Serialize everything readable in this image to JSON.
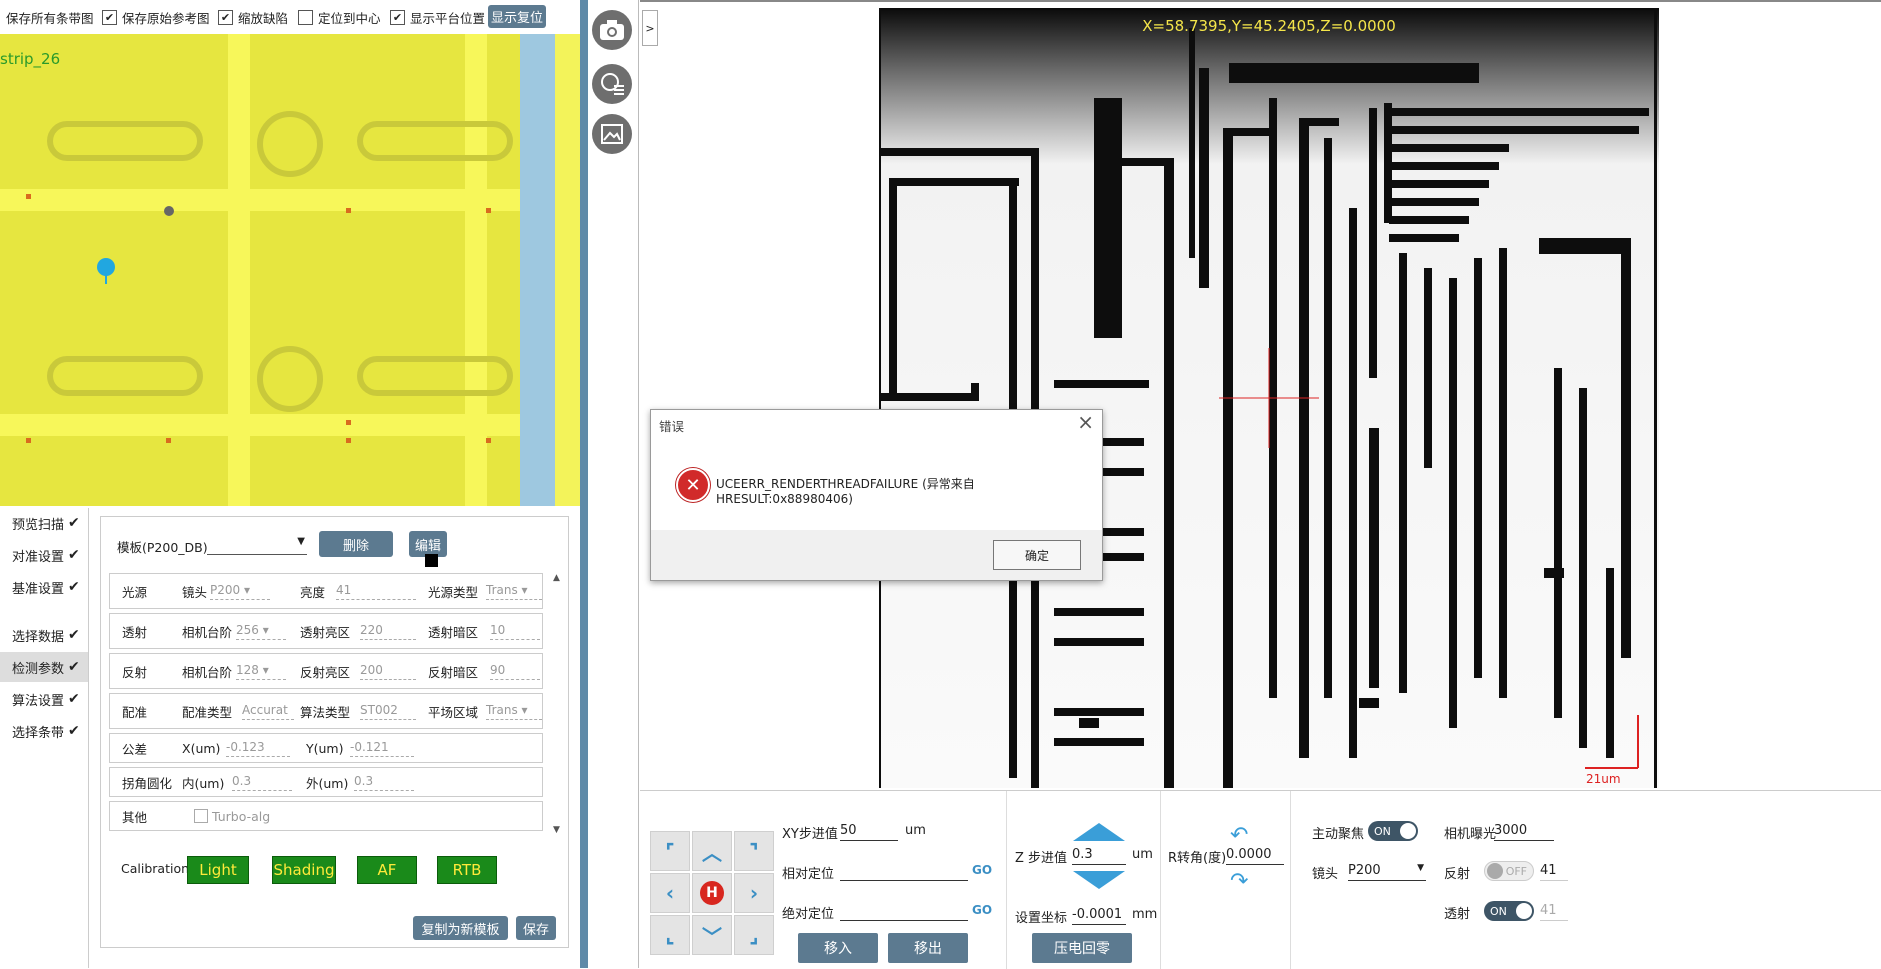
{
  "toolbar": {
    "save_all_strips": "保存所有条带图",
    "save_original_ref": "保存原始参考图",
    "zoom_defect": "缩放缺陷",
    "center_locate": "定位到中心",
    "show_platform_pos": "显示平台位置",
    "show_reset": "显示复位"
  },
  "map": {
    "strip_label": "strip_26"
  },
  "nav": {
    "items": [
      {
        "label": "预览扫描",
        "checked": "✔"
      },
      {
        "label": "对准设置",
        "checked": "✔"
      },
      {
        "label": "基准设置",
        "checked": "✔"
      },
      {
        "label": "选择数据",
        "checked": "✔"
      },
      {
        "label": "检测参数",
        "checked": "✔"
      },
      {
        "label": "算法设置",
        "checked": "✔"
      },
      {
        "label": "选择条带",
        "checked": "✔"
      }
    ]
  },
  "params": {
    "template_label": "模板(P200_DB)",
    "delete": "删除",
    "edit": "编辑",
    "rows": {
      "light": {
        "title": "光源",
        "lens_label": "镜头",
        "lens_val": "P200",
        "brightness_label": "亮度",
        "brightness_val": "41",
        "type_label": "光源类型",
        "type_val": "Trans"
      },
      "trans": {
        "title": "透射",
        "cam_label": "相机台阶",
        "cam_val": "256",
        "bright_label": "透射亮区",
        "bright_val": "220",
        "dark_label": "透射暗区",
        "dark_val": "10"
      },
      "refl": {
        "title": "反射",
        "cam_label": "相机台阶",
        "cam_val": "128",
        "bright_label": "反射亮区",
        "bright_val": "200",
        "dark_label": "反射暗区",
        "dark_val": "90"
      },
      "align": {
        "title": "配准",
        "type_label": "配准类型",
        "type_val": "Accurat",
        "alg_label": "算法类型",
        "alg_val": "ST002",
        "field_label": "平场区域",
        "field_val": "Trans"
      },
      "tol": {
        "title": "公差",
        "x_label": "X(um)",
        "x_val": "-0.123",
        "y_label": "Y(um)",
        "y_val": "-0.121"
      },
      "corner": {
        "title": "拐角圆化",
        "in_label": "内(um)",
        "in_val": "0.3",
        "out_label": "外(um)",
        "out_val": "0.3"
      },
      "other": {
        "title": "其他",
        "turbo": "Turbo-alg"
      }
    },
    "calibration_label": "Calibration",
    "cal_buttons": [
      "Light",
      "Shading",
      "AF",
      "RTB"
    ],
    "copy_new": "复制为新模板",
    "save": "保存"
  },
  "camera": {
    "coords": "X=58.7395,Y=45.2405,Z=0.0000",
    "scale": "21um",
    "expand": ">"
  },
  "dialog": {
    "title": "错误",
    "message": "UCEERR_RENDERTHREADFAILURE (异常来自 HRESULT:0x88980406)",
    "ok": "确定",
    "close": "×"
  },
  "controls": {
    "xy_step_label": "XY步进值",
    "xy_step_val": "50",
    "xy_unit": "um",
    "rel_pos": "相对定位",
    "abs_pos": "绝对定位",
    "go": "GO",
    "move_in": "移入",
    "move_out": "移出",
    "home": "H",
    "z_step_label": "Z 步进值",
    "z_step_val": "0.3",
    "z_unit": "um",
    "set_coord_label": "设置坐标",
    "set_coord_val": "-0.0001",
    "set_coord_unit": "mm",
    "piezo_reset": "压电回零",
    "r_label": "R转角(度)",
    "r_val": "0.0000",
    "autofocus": "主动聚焦",
    "af_on": "ON",
    "exposure_label": "相机曝光",
    "exposure_val": "3000",
    "lens_label": "镜头",
    "lens_val": "P200",
    "refl_label": "反射",
    "refl_state": "OFF",
    "refl_val": "41",
    "trans_label": "透射",
    "trans_state": "ON",
    "trans_val": "41"
  }
}
